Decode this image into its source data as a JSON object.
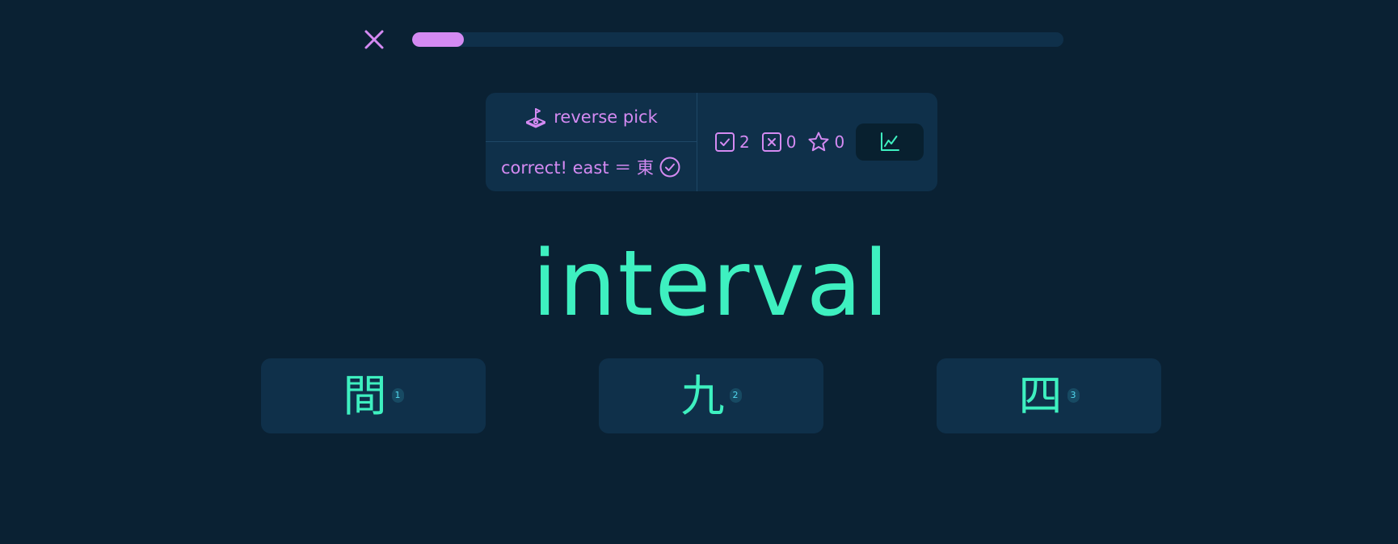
{
  "header": {
    "close_icon": "close-icon",
    "progress": 0.08
  },
  "info": {
    "mode_icon": "joystick-icon",
    "mode_label": "reverse pick",
    "feedback_text": "correct! east ＝ 東",
    "feedback_icon": "check-circle-icon",
    "stats": {
      "correct": "2",
      "wrong": "0",
      "starred": "0"
    },
    "stats_button_icon": "chart-line-icon"
  },
  "prompt": {
    "word": "interval"
  },
  "choices": [
    {
      "glyph": "間",
      "key": "1"
    },
    {
      "glyph": "九",
      "key": "2"
    },
    {
      "glyph": "四",
      "key": "3"
    }
  ],
  "colors": {
    "background": "#0a2133",
    "panel": "#0f304a",
    "accent_purple": "#d48af2",
    "accent_green": "#3ef0c0"
  }
}
